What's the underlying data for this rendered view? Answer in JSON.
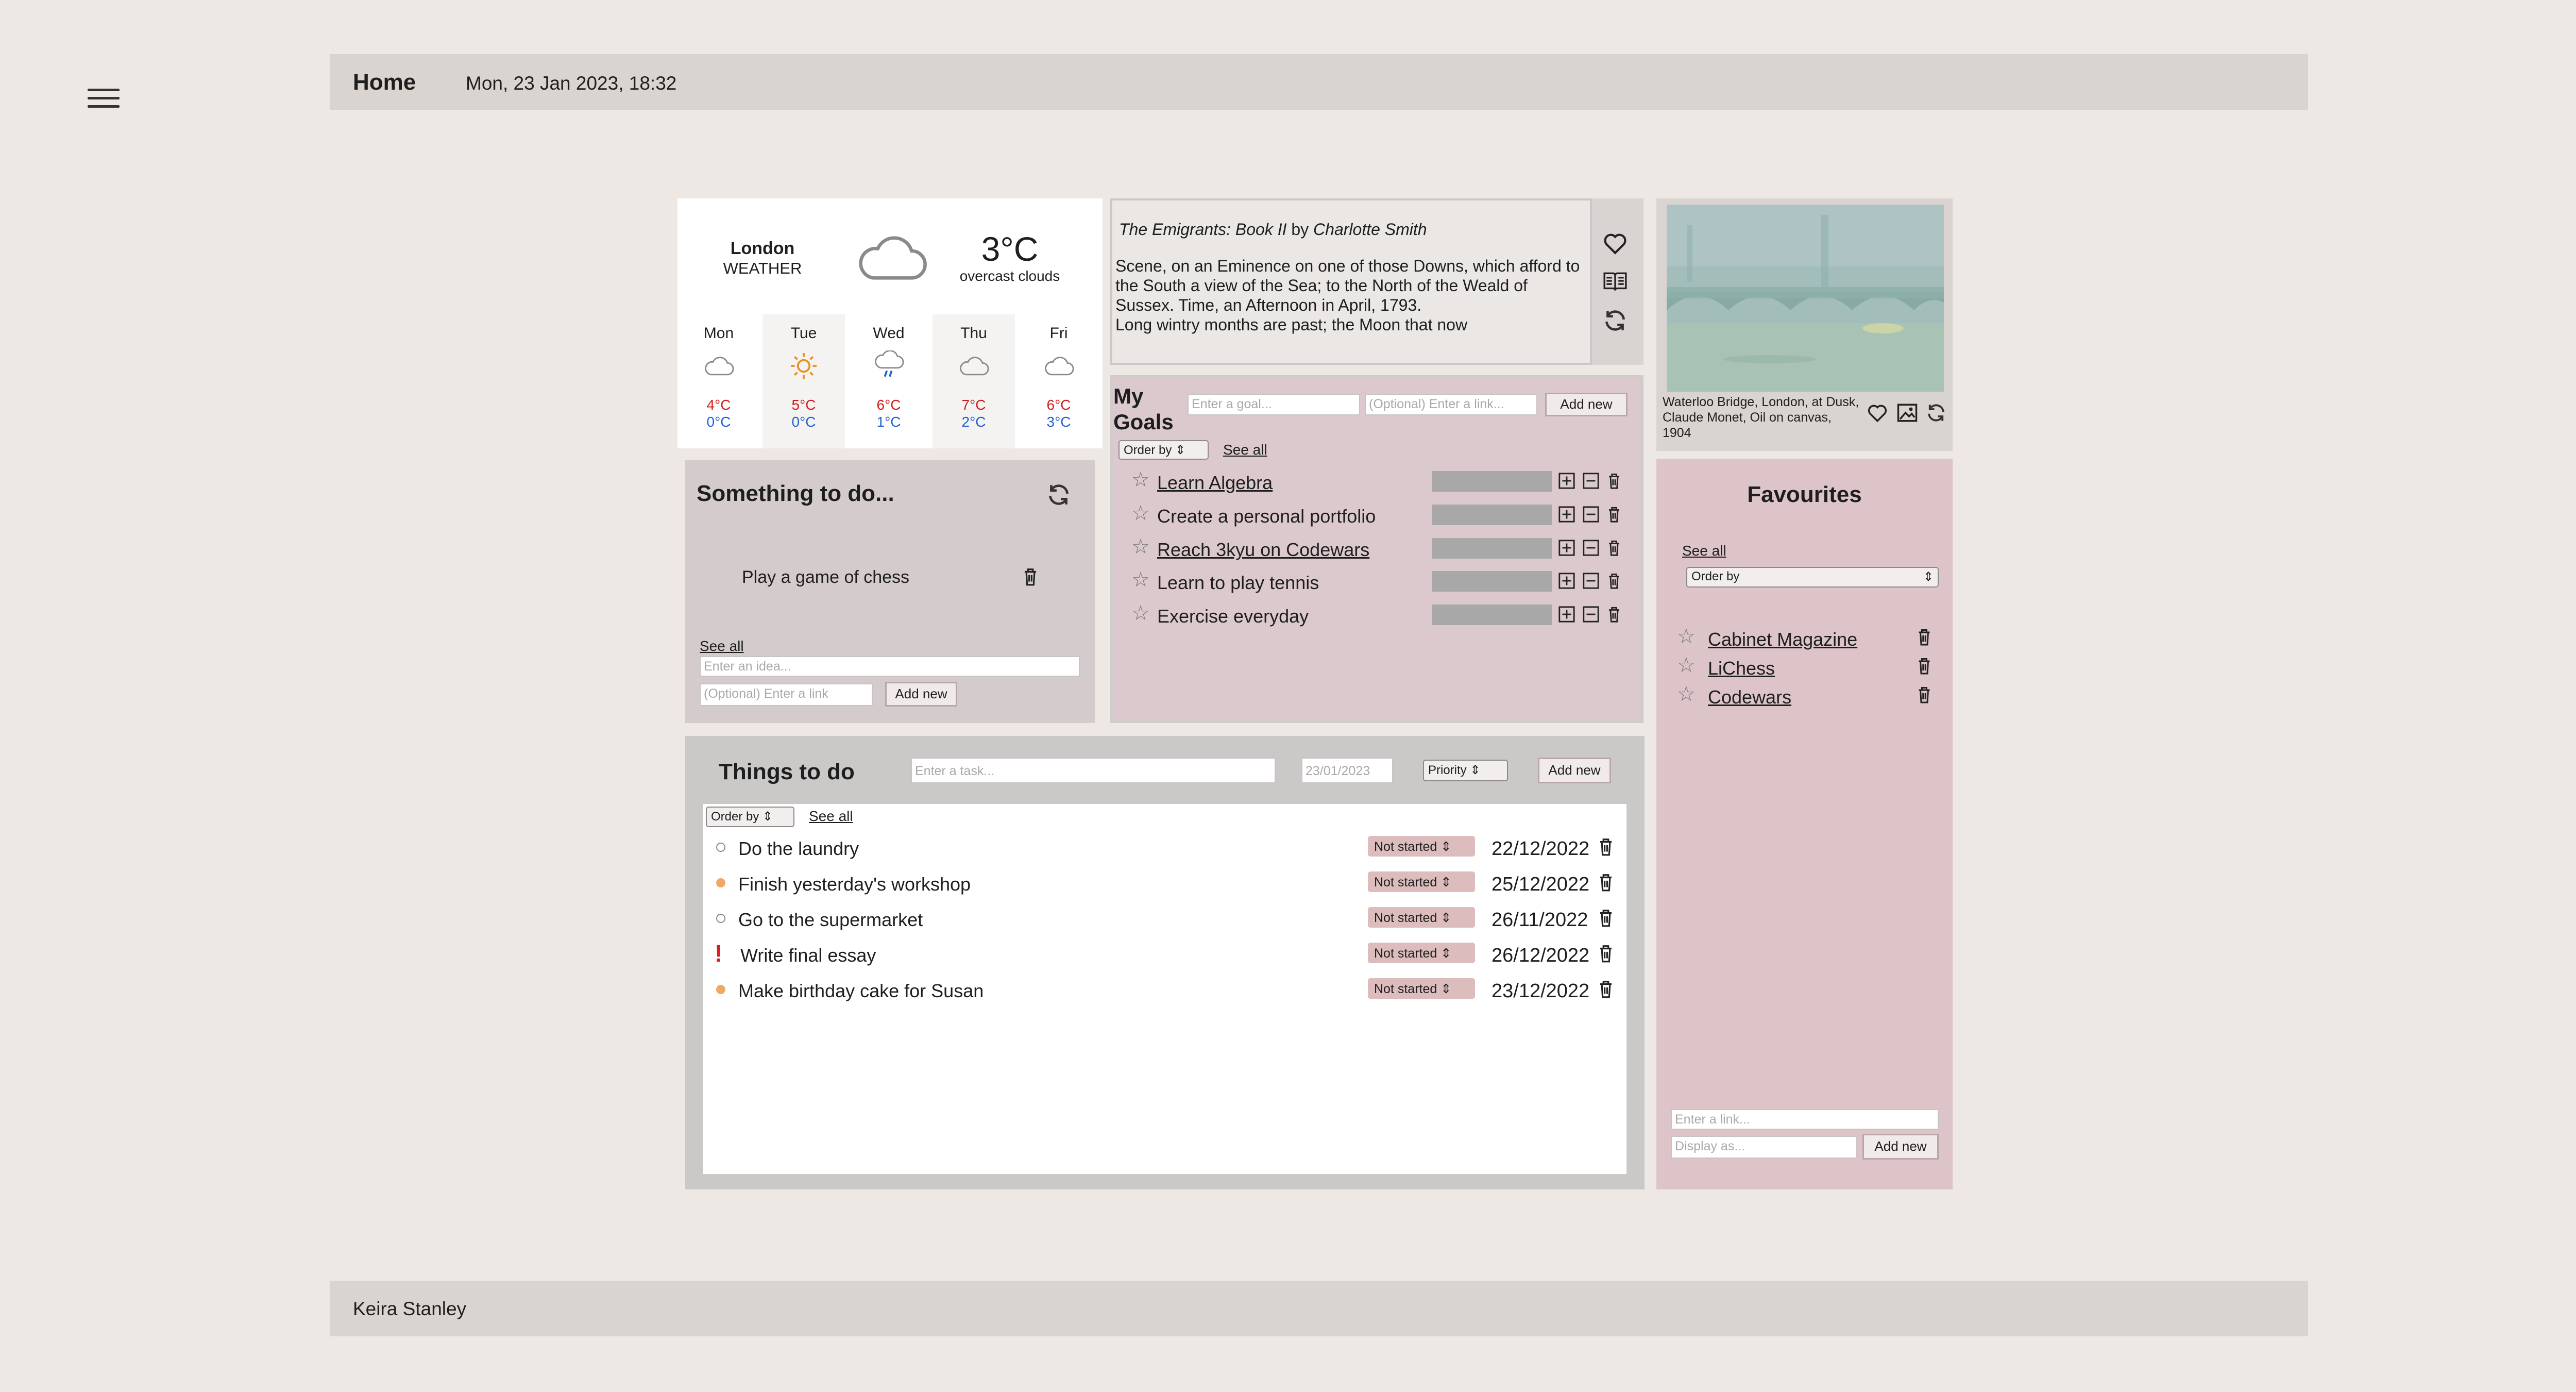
{
  "header": {
    "title": "Home",
    "datetime": "Mon, 23 Jan 2023, 18:32"
  },
  "footer": {
    "name": "Keira Stanley"
  },
  "weather": {
    "city": "London",
    "label": "WEATHER",
    "temp": "3°C",
    "description": "overcast clouds",
    "icon": "cloud-icon",
    "days": [
      {
        "name": "Mon",
        "icon": "cloud-icon",
        "high": "4°C",
        "low": "0°C"
      },
      {
        "name": "Tue",
        "icon": "sun-icon",
        "high": "5°C",
        "low": "0°C"
      },
      {
        "name": "Wed",
        "icon": "rain-cloud-icon",
        "high": "6°C",
        "low": "1°C"
      },
      {
        "name": "Thu",
        "icon": "cloud-icon",
        "high": "7°C",
        "low": "2°C"
      },
      {
        "name": "Fri",
        "icon": "cloud-icon",
        "high": "6°C",
        "low": "3°C"
      }
    ]
  },
  "book": {
    "title": "The Emigrants: Book II",
    "by": " by ",
    "author": "Charlotte Smith",
    "lines": [
      " Scene, on an Eminence on one of those Downs, which afford to the South a view of the Sea; to the North of the Weald of Sussex. Time, an Afternoon in April, 1793.",
      " Long wintry months are past; the Moon that now"
    ]
  },
  "art": {
    "caption": "Waterloo Bridge, London, at Dusk, Claude Monet, Oil on canvas, 1904"
  },
  "goals": {
    "title": "My Goals",
    "goal_placeholder": "Enter a goal...",
    "link_placeholder": "(Optional) Enter a link...",
    "add_label": "Add new",
    "order_label": "Order by",
    "see_all": "See all",
    "items": [
      {
        "label": "Learn Algebra",
        "is_link": true
      },
      {
        "label": "Create a personal portfolio",
        "is_link": false
      },
      {
        "label": "Reach 3kyu on Codewars",
        "is_link": true
      },
      {
        "label": "Learn to play tennis",
        "is_link": false
      },
      {
        "label": "Exercise everyday",
        "is_link": false
      }
    ]
  },
  "something": {
    "title": "Something to do...",
    "idea": "Play a game of chess",
    "see_all": "See all",
    "idea_placeholder": "Enter an idea...",
    "link_placeholder": "(Optional) Enter a link",
    "add_label": "Add new"
  },
  "things": {
    "title": "Things to do",
    "task_placeholder": "Enter a task...",
    "date_value": "23/01/2023",
    "priority_label": "Priority",
    "add_label": "Add new",
    "order_label": "Order by",
    "see_all": "See all",
    "tasks": [
      {
        "label": "Do the laundry",
        "priority": "low",
        "status": "Not started",
        "date": "22/12/2022"
      },
      {
        "label": "Finish yesterday's workshop",
        "priority": "medium",
        "status": "Not started",
        "date": "25/12/2022"
      },
      {
        "label": "Go to the supermarket",
        "priority": "low",
        "status": "Not started",
        "date": "26/11/2022"
      },
      {
        "label": "Write final essay",
        "priority": "high",
        "status": "Not started",
        "date": "26/12/2022"
      },
      {
        "label": "Make birthday cake for Susan",
        "priority": "medium",
        "status": "Not started",
        "date": "23/12/2022"
      }
    ],
    "priority_colors": {
      "low": "#ffffff",
      "medium": "#f0a868",
      "high": "#e01b1b"
    }
  },
  "favourites": {
    "title": "Favourites",
    "see_all": "See all",
    "order_label": "Order by",
    "items": [
      {
        "label": "Cabinet Magazine"
      },
      {
        "label": "LiChess"
      },
      {
        "label": "Codewars"
      }
    ],
    "link_placeholder": "Enter a link...",
    "display_placeholder": "Display as...",
    "add_label": "Add new"
  },
  "colors": {
    "background": "#ede8e4",
    "header": "#dad4d1",
    "goals_panel": "#dcc9cd",
    "favourites_panel": "#dcc4c8",
    "temp_high": "#d01919",
    "temp_low": "#1d5fd0"
  }
}
